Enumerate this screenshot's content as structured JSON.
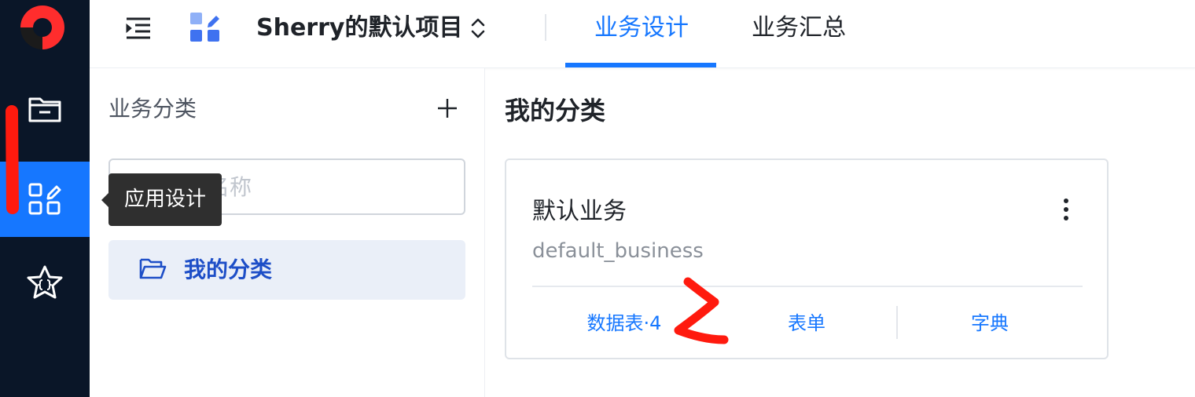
{
  "header": {
    "project_name": "Sherry的默认项目",
    "tabs": [
      {
        "label": "业务设计",
        "active": true
      },
      {
        "label": "业务汇总",
        "active": false
      }
    ]
  },
  "tooltip": {
    "text": "应用设计"
  },
  "category_panel": {
    "title": "业务分类",
    "search_placeholder": "分类名称",
    "items": [
      {
        "label": "我的分类",
        "selected": true
      }
    ]
  },
  "main": {
    "title": "我的分类",
    "card": {
      "name": "默认业务",
      "code": "default_business",
      "actions": [
        "数据表·4",
        "表单",
        "字典"
      ]
    }
  },
  "colors": {
    "accent": "#1677ff",
    "rail_background": "#0a1628",
    "selected_item_bg": "#eaeff8",
    "annotation_red": "#ff1a0e"
  },
  "icons": {
    "rail": [
      "brand-logo-icon",
      "folder-icon",
      "app-design-icon",
      "star-code-icon"
    ],
    "header": [
      "menu-indent-icon",
      "app-grid-edit-icon",
      "chevron-up-down-icon"
    ],
    "panel": [
      "plus-icon",
      "search-icon",
      "folder-open-icon"
    ],
    "card": [
      "more-vertical-icon"
    ]
  }
}
